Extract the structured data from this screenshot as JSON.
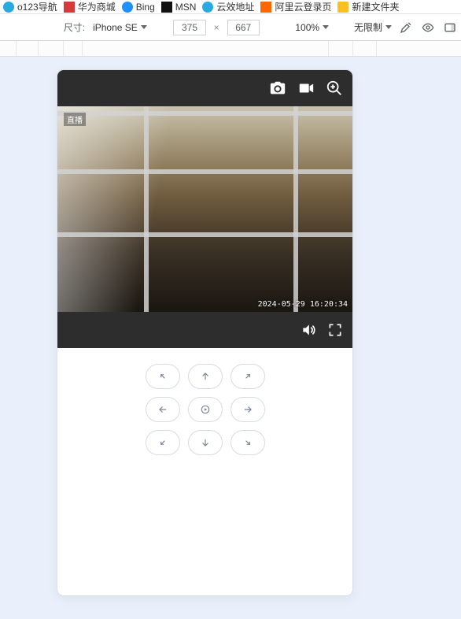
{
  "bookmarks": [
    {
      "label": "o123导航",
      "fav": "fav-lb"
    },
    {
      "label": "华为商城",
      "fav": "fav-red"
    },
    {
      "label": "Bing",
      "fav": "fav-blue"
    },
    {
      "label": "MSN",
      "fav": "fav-dark"
    },
    {
      "label": "云效地址",
      "fav": "fav-lb"
    },
    {
      "label": "阿里云登录页",
      "fav": "fav-orange"
    },
    {
      "label": "新建文件夹",
      "fav": "fav-yellow"
    }
  ],
  "devtools": {
    "size_label": "尺寸:",
    "device_name": "iPhone SE",
    "width": "375",
    "height": "667",
    "times": "×",
    "zoom": "100%",
    "throttle": "无限制"
  },
  "camera": {
    "badge": "直播",
    "timestamp": "2024-05-29 16:20:34"
  },
  "ptz": {
    "names": [
      "ptz-up-left",
      "ptz-up",
      "ptz-up-right",
      "ptz-left",
      "ptz-center-play",
      "ptz-right",
      "ptz-down-left",
      "ptz-down",
      "ptz-down-right"
    ]
  }
}
